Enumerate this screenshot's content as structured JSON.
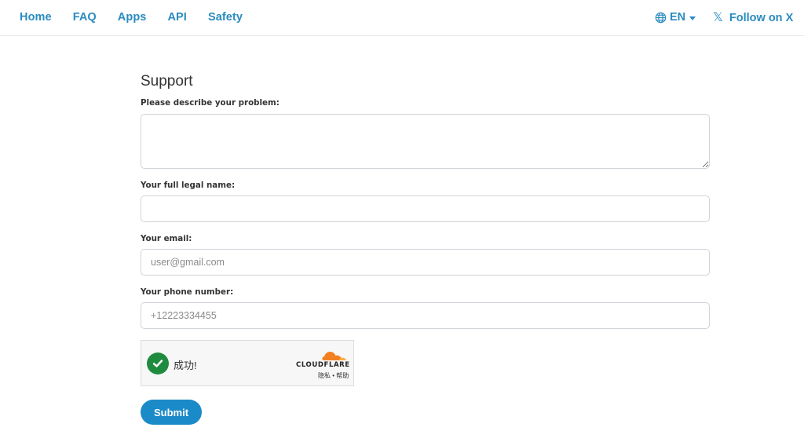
{
  "nav": {
    "links": [
      "Home",
      "FAQ",
      "Apps",
      "API",
      "Safety"
    ],
    "language": "EN",
    "follow": "Follow on X",
    "x_glyph": "𝕏"
  },
  "form": {
    "title": "Support",
    "problem_label": "Please describe your problem:",
    "problem_value": "",
    "name_label": "Your full legal name:",
    "name_value": "",
    "email_label": "Your email:",
    "email_placeholder": "user@gmail.com",
    "phone_label": "Your phone number:",
    "phone_placeholder": "+12223334455",
    "submit": "Submit"
  },
  "captcha": {
    "status": "成功!",
    "brand": "CLOUDFLARE",
    "links": "隐私 • 帮助"
  },
  "colors": {
    "accent": "#2a8bc0",
    "button": "#1b8ac8",
    "success": "#1f8b3e",
    "cloudflare_orange": "#f38020"
  }
}
